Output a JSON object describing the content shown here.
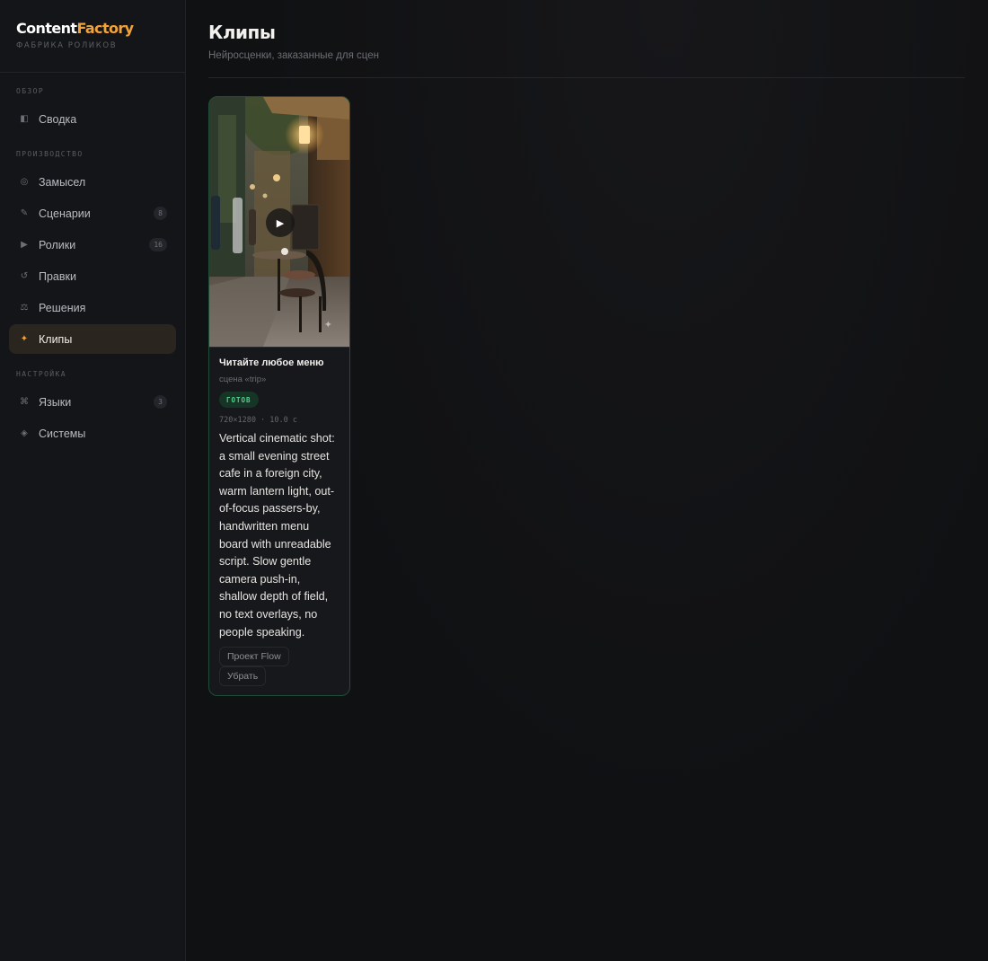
{
  "brand": {
    "name_part1": "Content",
    "name_part2": "Factory",
    "subtitle": "ФАБРИКА РОЛИКОВ"
  },
  "sidebar": {
    "sections": [
      {
        "title": "ОБЗОР",
        "items": [
          {
            "label": "Сводка",
            "icon": "panel-icon",
            "glyph": "◧",
            "badge": ""
          }
        ]
      },
      {
        "title": "ПРОИЗВОДСТВО",
        "items": [
          {
            "label": "Замысел",
            "icon": "idea-icon",
            "glyph": "◎",
            "badge": ""
          },
          {
            "label": "Сценарии",
            "icon": "pen-icon",
            "glyph": "✎",
            "badge": "8"
          },
          {
            "label": "Ролики",
            "icon": "play-icon",
            "glyph": "▶",
            "badge": "16"
          },
          {
            "label": "Правки",
            "icon": "revision-icon",
            "glyph": "↺",
            "badge": ""
          },
          {
            "label": "Решения",
            "icon": "decisions-icon",
            "glyph": "⚖",
            "badge": ""
          },
          {
            "label": "Клипы",
            "icon": "sparkle-icon",
            "glyph": "✦",
            "badge": "",
            "active": true
          }
        ]
      },
      {
        "title": "НАСТРОЙКА",
        "items": [
          {
            "label": "Языки",
            "icon": "languages-icon",
            "glyph": "⌘",
            "badge": "3"
          },
          {
            "label": "Системы",
            "icon": "systems-icon",
            "glyph": "◈",
            "badge": ""
          }
        ]
      }
    ]
  },
  "page": {
    "title": "Клипы",
    "subtitle": "Нейросценки, заказанные для сцен"
  },
  "clips": [
    {
      "title": "Читайте любое меню",
      "scene": "сцена «trip»",
      "status": "ГОТОВ",
      "meta": "720×1280 · 10.0 с",
      "prompt": "Vertical cinematic shot: a small evening street cafe in a foreign city, warm lantern light, out-of-focus passers-by, handwritten menu board with unreadable script. Slow gentle camera push-in, shallow depth of field, no text overlays, no people speaking.",
      "actions": [
        "Проект Flow",
        "Убрать"
      ]
    }
  ],
  "colors": {
    "accent": "#f2a23a",
    "ready": "#4fd48b",
    "card_border": "#1f4d38"
  }
}
